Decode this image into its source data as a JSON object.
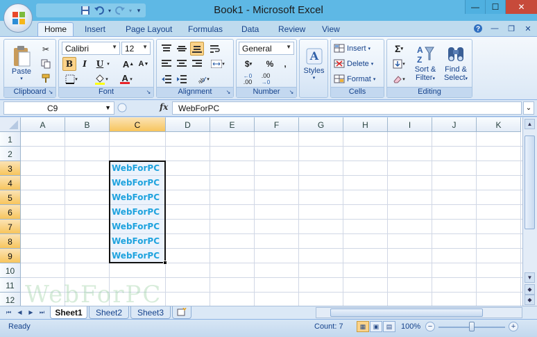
{
  "window": {
    "title": "Book1 - Microsoft Excel",
    "controls": {
      "minimize": "—",
      "maximize": "☐",
      "close": "✕"
    }
  },
  "qat": {
    "dropdown": "▾"
  },
  "ribbon_tabs": [
    "Home",
    "Insert",
    "Page Layout",
    "Formulas",
    "Data",
    "Review",
    "View"
  ],
  "ribbon": {
    "clipboard": {
      "label": "Clipboard",
      "paste": "Paste"
    },
    "font": {
      "label": "Font",
      "name": "Calibri",
      "size": "12",
      "bold": "B",
      "italic": "I",
      "underline": "U",
      "grow": "A",
      "shrink": "A",
      "font_color_glyph": "A"
    },
    "alignment": {
      "label": "Alignment"
    },
    "number": {
      "label": "Number",
      "format": "General",
      "currency": "$",
      "percent": "%",
      "comma": ",",
      "inc_decimal": ".00",
      "dec_decimal": ".00"
    },
    "styles": {
      "label": "Styles"
    },
    "cells": {
      "label": "Cells",
      "insert": "Insert",
      "delete": "Delete",
      "format": "Format"
    },
    "editing": {
      "label": "Editing",
      "sort_filter_1": "Sort &",
      "sort_filter_2": "Filter",
      "find_select_1": "Find &",
      "find_select_2": "Select"
    }
  },
  "formula_bar": {
    "name_box": "C9",
    "fx": "fx",
    "content": "WebForPC"
  },
  "grid": {
    "columns": [
      "A",
      "B",
      "C",
      "D",
      "E",
      "F",
      "G",
      "H",
      "I",
      "J",
      "K"
    ],
    "rows": [
      "1",
      "2",
      "3",
      "4",
      "5",
      "6",
      "7",
      "8",
      "9",
      "10",
      "11",
      "12"
    ],
    "selected_column": "C",
    "selected_rows": [
      "3",
      "4",
      "5",
      "6",
      "7",
      "8",
      "9"
    ],
    "cells": [
      {
        "ref": "C3",
        "value": "WebForPC"
      },
      {
        "ref": "C4",
        "value": "WebForPC"
      },
      {
        "ref": "C5",
        "value": "WebForPC"
      },
      {
        "ref": "C6",
        "value": "WebForPC"
      },
      {
        "ref": "C7",
        "value": "WebForPC"
      },
      {
        "ref": "C8",
        "value": "WebForPC"
      },
      {
        "ref": "C9",
        "value": "WebForPC"
      }
    ],
    "cell_text_color": "#1fa3de",
    "watermark": "WebForPC"
  },
  "sheets": [
    "Sheet1",
    "Sheet2",
    "Sheet3"
  ],
  "active_sheet": "Sheet1",
  "status": {
    "ready": "Ready",
    "count": "Count: 7",
    "zoom": "100%",
    "zoom_minus": "−",
    "zoom_plus": "+"
  }
}
